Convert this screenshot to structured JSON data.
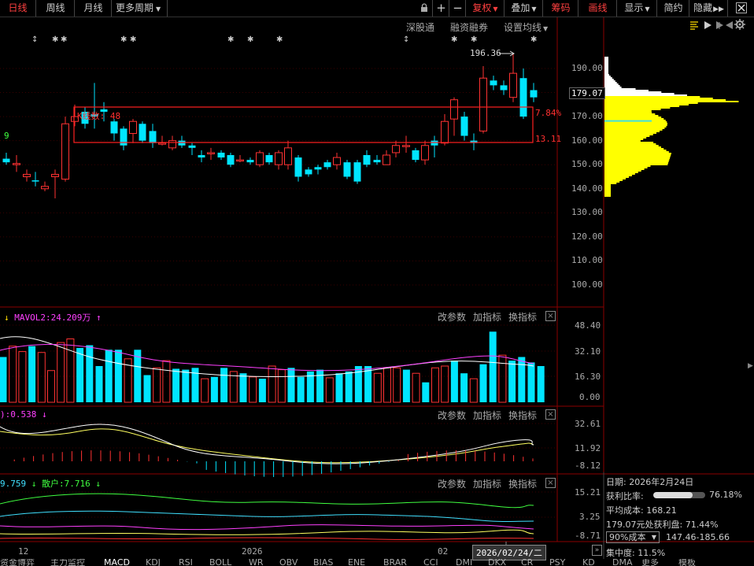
{
  "toolbar": {
    "left_tabs": [
      "日线",
      "周线",
      "月线",
      "更多周期"
    ],
    "right_items": [
      "复权",
      "叠加",
      "筹码",
      "画线",
      "显示",
      "简约",
      "隐藏"
    ],
    "plus": "+",
    "minus": "−"
  },
  "main_chart": {
    "links": [
      "深股通",
      "融资融券",
      "设置均线"
    ],
    "price_ticks": [
      "190.00",
      "180.00",
      "170.00",
      "160.00",
      "150.00",
      "140.00",
      "130.00",
      "120.00",
      "110.00",
      "100.00"
    ],
    "current_price": "179.07",
    "high_label": "196.36",
    "range_label": "K线数: 48",
    "range_top_pct": "7.84%",
    "range_bottom_pct": "13.11",
    "left_value": "9"
  },
  "volume_panel": {
    "title": "MAVOL2:24.209万",
    "ticks": [
      "48.40",
      "32.10",
      "16.30",
      "0.00"
    ],
    "links": [
      "改参数",
      "加指标",
      "换指标"
    ]
  },
  "macd_panel": {
    "title": "):0.538",
    "ticks": [
      "32.61",
      "11.92",
      "-8.12"
    ],
    "links": [
      "改参数",
      "加指标",
      "换指标"
    ]
  },
  "flow_panel": {
    "title_a": "9.759",
    "title_b": "散户:7.716",
    "ticks": [
      "15.21",
      "3.25",
      "-8.71"
    ],
    "links": [
      "改参数",
      "加指标",
      "换指标"
    ]
  },
  "x_axis": {
    "labels": [
      "12",
      "2026",
      "02"
    ],
    "cursor_date": "2026/02/24/二"
  },
  "chip_info": {
    "date": "日期: 2026年2月24日",
    "profit_ratio_label": "获利比率:",
    "profit_ratio": "76.18%",
    "avg_cost": "平均成本: 168.21",
    "profit_at": "179.07元处获利盘: 71.44%",
    "cost_select": "90%成本",
    "cost_range": "147.46-185.66",
    "concentration": "集中度: 11.5%",
    "profit_fill": 0.7618
  },
  "bottom_tabs": [
    "资金博弈",
    "主力监控",
    "MACD",
    "KDJ",
    "RSI",
    "BOLL",
    "WR",
    "OBV",
    "BIAS",
    "ENE",
    "BRAR",
    "CCI",
    "DMI",
    "DKX",
    "CR",
    "PSY",
    "KD",
    "DMA",
    "更多",
    "模板"
  ],
  "colors": {
    "up": "#ff3232",
    "down": "#00e5ff",
    "accent_red": "#ff4040",
    "chip_yellow": "#ffff00"
  }
}
